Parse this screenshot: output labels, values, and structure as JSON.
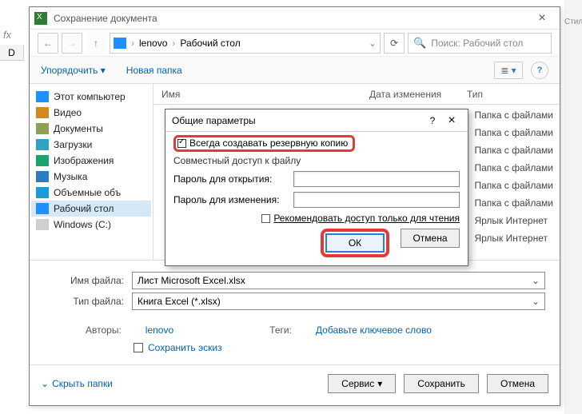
{
  "bg": {
    "fx": "fx",
    "col": "D",
    "side": "Стил"
  },
  "dialog": {
    "title": "Сохранение документа",
    "nav": {
      "crumb1": "lenovo",
      "crumb2": "Рабочий стол",
      "search_placeholder": "Поиск: Рабочий стол"
    },
    "toolbar": {
      "organize": "Упорядочить",
      "new_folder": "Новая папка"
    },
    "columns": {
      "name": "Имя",
      "date": "Дата изменения",
      "type": "Тип"
    },
    "tree": [
      "Этот компьютер",
      "Видео",
      "Документы",
      "Загрузки",
      "Изображения",
      "Музыка",
      "Объемные объ",
      "Рабочий стол",
      "Windows (C:)"
    ],
    "type_cells": [
      "Папка с файлами",
      "Папка с файлами",
      "Папка с файлами",
      "Папка с файлами",
      "Папка с файлами",
      "Папка с файлами",
      "Ярлык Интернет",
      "Ярлык Интернет"
    ],
    "form": {
      "filename_label": "Имя файла:",
      "filename_value": "Лист Microsoft Excel.xlsx",
      "filetype_label": "Тип файла:",
      "filetype_value": "Книга Excel (*.xlsx)",
      "authors_label": "Авторы:",
      "authors_value": "lenovo",
      "tags_label": "Теги:",
      "tags_value": "Добавьте ключевое слово",
      "save_thumb": "Сохранить эскиз"
    },
    "footer": {
      "hide": "Скрыть папки",
      "service": "Сервис",
      "save": "Сохранить",
      "cancel": "Отмена"
    }
  },
  "modal": {
    "title": "Общие параметры",
    "backup": "Всегда создавать резервную копию",
    "share_label": "Совместный доступ к файлу",
    "pw_open": "Пароль для открытия:",
    "pw_mod": "Пароль для изменения:",
    "readonly": "Рекомендовать доступ только для чтения",
    "ok": "ОК",
    "cancel": "Отмена"
  }
}
